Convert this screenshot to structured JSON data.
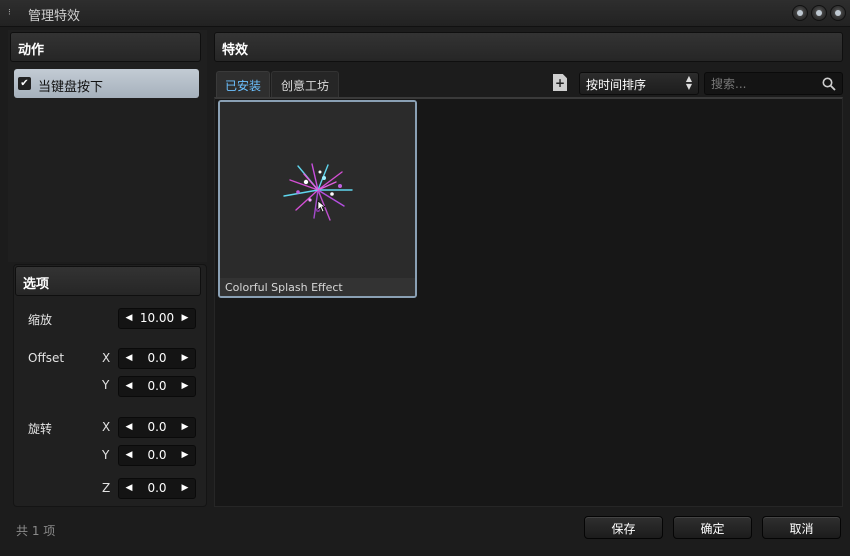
{
  "window": {
    "title": "管理特效"
  },
  "actions": {
    "header": "动作",
    "items": [
      {
        "label": "当键盘按下",
        "checked": true
      }
    ]
  },
  "options": {
    "header": "选项",
    "scale": {
      "label": "缩放",
      "value": "10.00"
    },
    "offset": {
      "label": "Offset",
      "x_label": "X",
      "x": "0.0",
      "y_label": "Y",
      "y": "0.0"
    },
    "rotation": {
      "label": "旋转",
      "x_label": "X",
      "x": "0.0",
      "y_label": "Y",
      "y": "0.0",
      "z_label": "Z",
      "z": "0.0"
    }
  },
  "effects": {
    "header": "特效",
    "tabs": [
      {
        "label": "已安装",
        "active": true
      },
      {
        "label": "创意工坊",
        "active": false
      }
    ],
    "sort": {
      "selected": "按时间排序"
    },
    "search": {
      "placeholder": "搜索..."
    },
    "items": [
      {
        "name": "Colorful Splash Effect"
      }
    ]
  },
  "footer": {
    "count_text": "共 1 项",
    "save_label": "保存",
    "ok_label": "确定",
    "cancel_label": "取消"
  },
  "colors": {
    "accent": "#6cc1ff",
    "selection": "#a6b1bc",
    "card_border": "#8aa0b4"
  }
}
